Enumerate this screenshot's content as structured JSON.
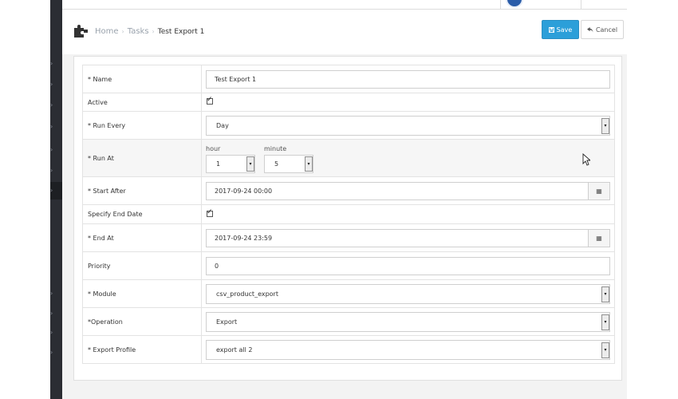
{
  "breadcrumb": {
    "home": "Home",
    "tasks": "Tasks",
    "current": "Test Export 1"
  },
  "toolbar": {
    "save_label": "Save",
    "cancel_label": "Cancel",
    "save_icon": "floppy-disk-icon",
    "cancel_icon": "reply-arrow-icon"
  },
  "form": {
    "name": {
      "label": "* Name",
      "value": "Test Export 1"
    },
    "active": {
      "label": "Active",
      "checked": true
    },
    "run_every": {
      "label": "* Run Every",
      "value": "Day"
    },
    "run_at": {
      "label": "* Run At",
      "hour_label": "hour",
      "minute_label": "minute",
      "hour": "1",
      "minute": "5"
    },
    "start_after": {
      "label": "* Start After",
      "value": "2017-09-24 00:00"
    },
    "specify_end_date": {
      "label": "Specify End Date",
      "checked": true
    },
    "end_at": {
      "label": "* End At",
      "value": "2017-09-24 23:59"
    },
    "priority": {
      "label": "Priority",
      "value": "0"
    },
    "module": {
      "label": "* Module",
      "value": "csv_product_export"
    },
    "operation": {
      "label": "*Operation",
      "value": "Export"
    },
    "export_profile": {
      "label": "* Export Profile",
      "value": "export all 2"
    }
  },
  "colors": {
    "sidebar": "#2b2d33",
    "primary": "#2c9fd9",
    "background": "#f3f3f3"
  }
}
